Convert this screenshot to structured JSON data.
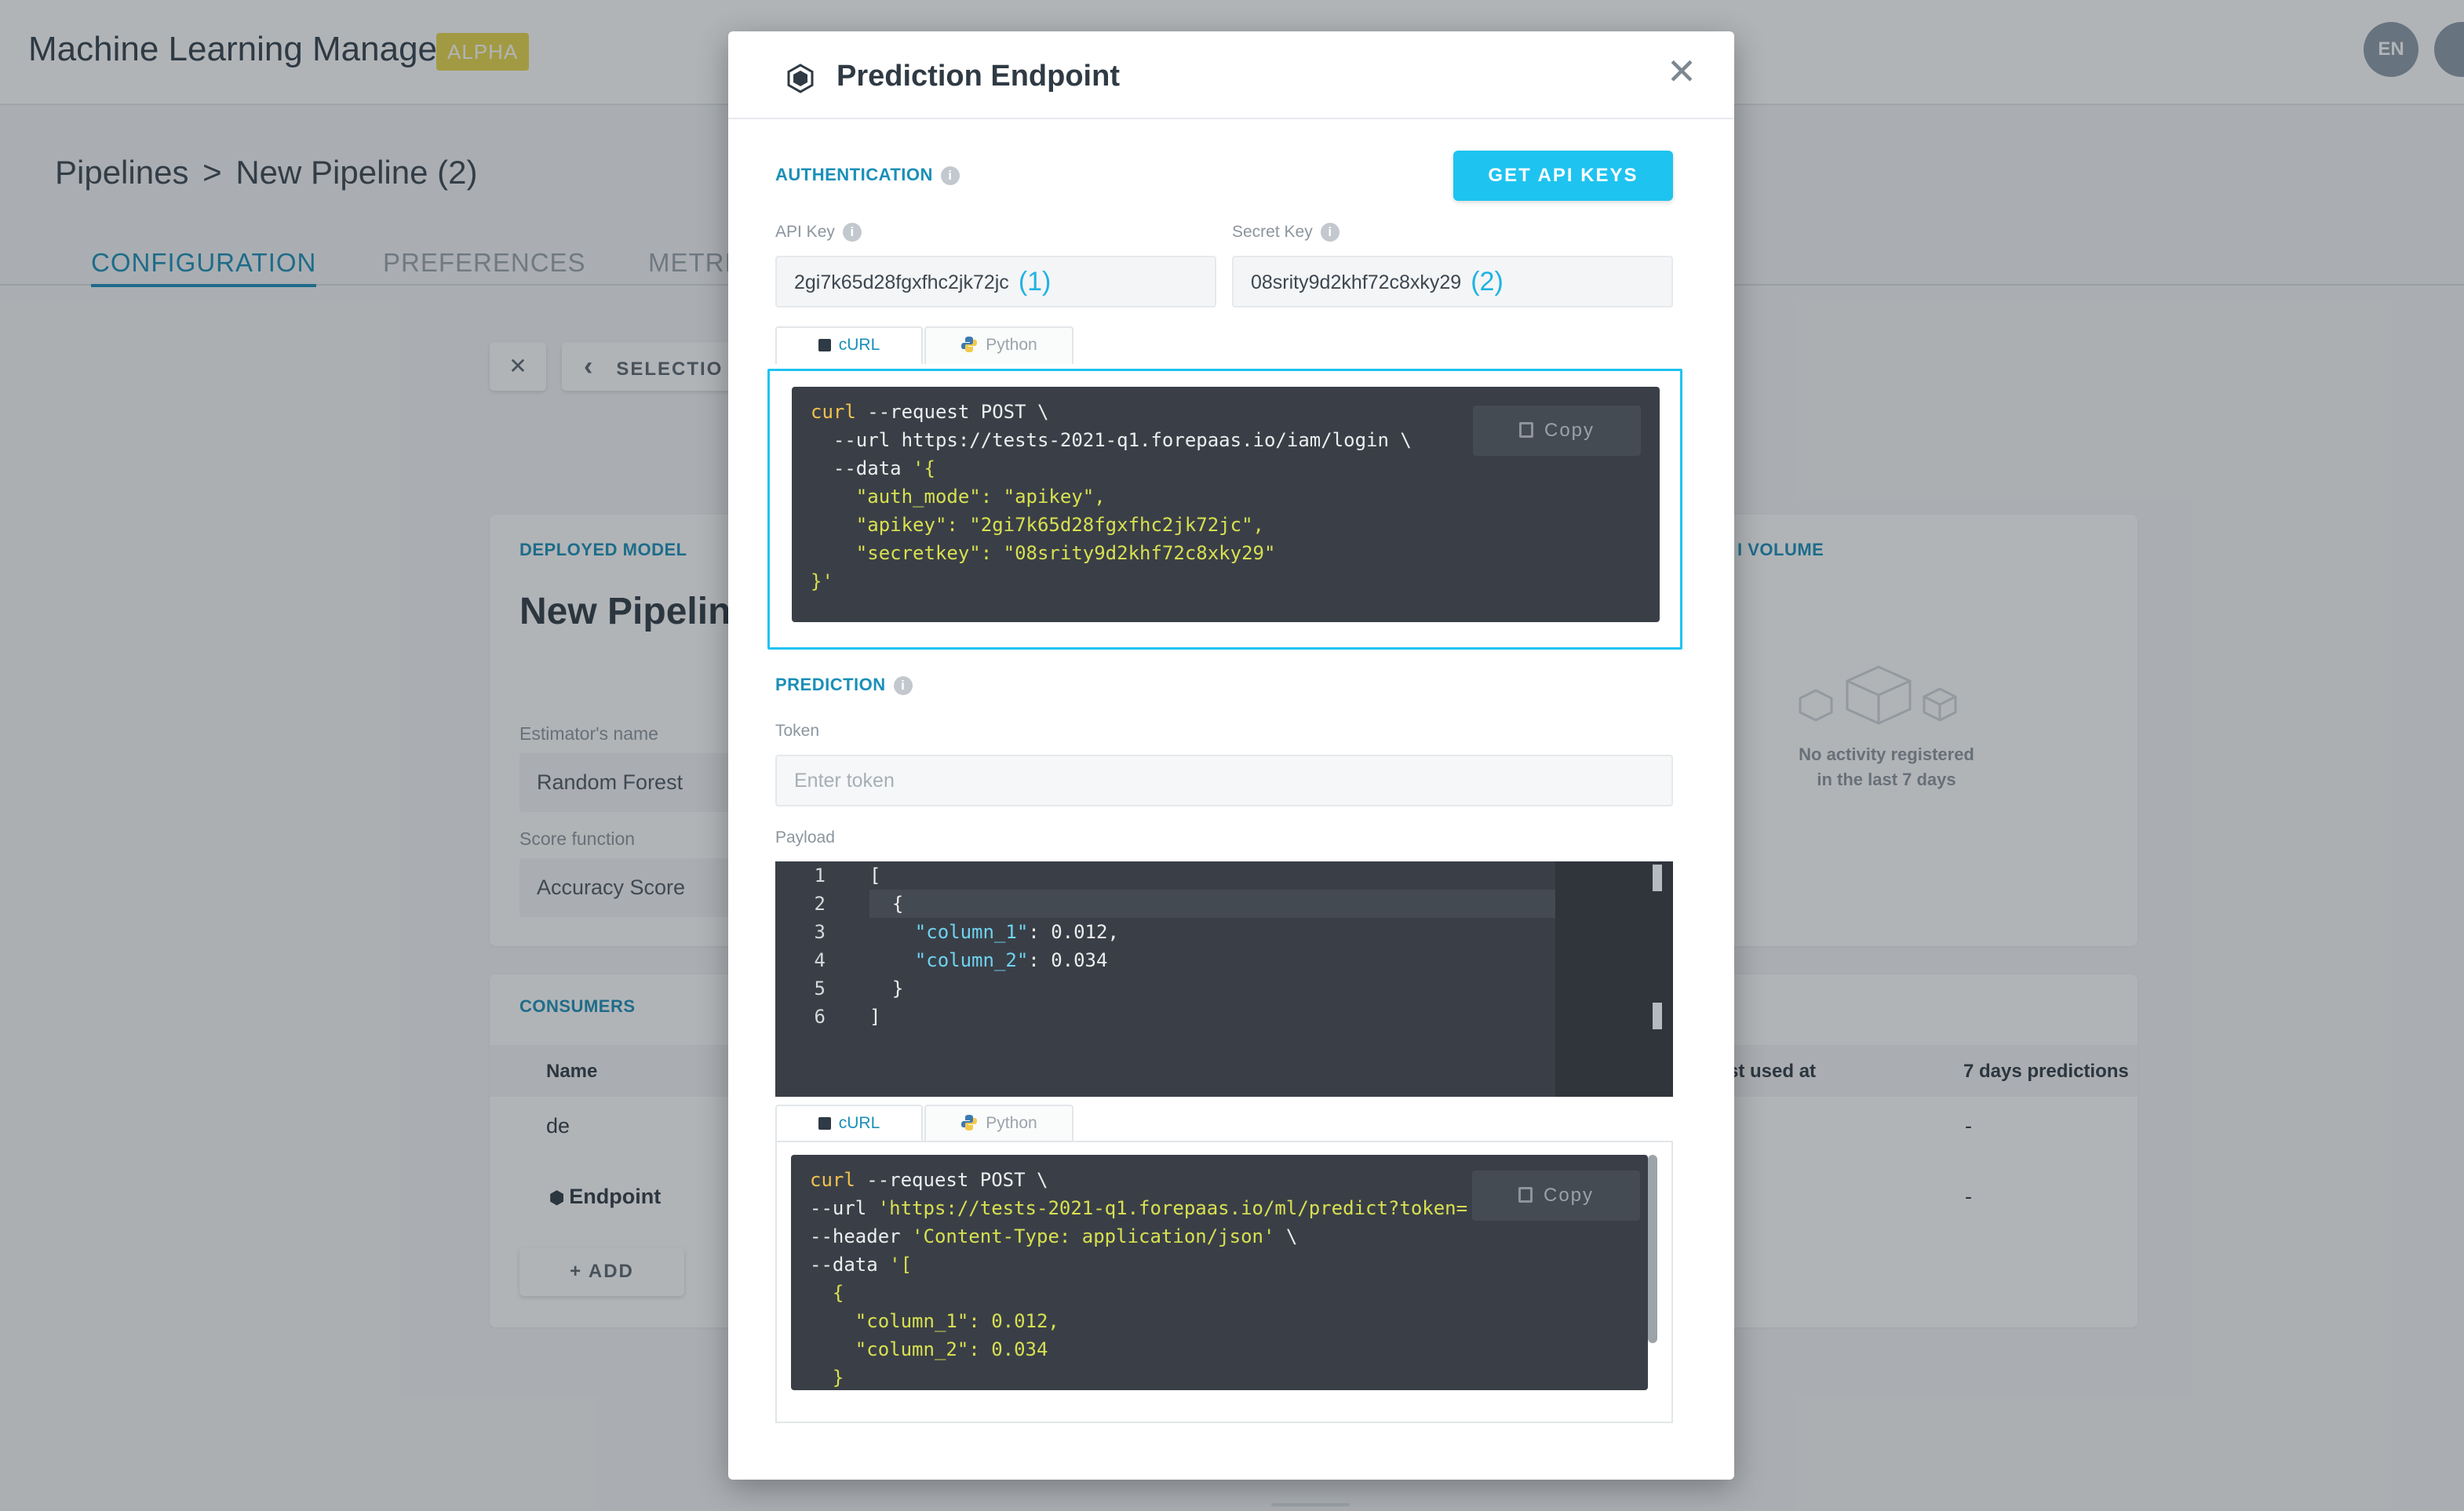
{
  "app": {
    "title": "Machine Learning Manager",
    "badge": "ALPHA",
    "lang": "EN"
  },
  "breadcrumb": {
    "root": "Pipelines",
    "separator": ">",
    "current": "New Pipeline (2)"
  },
  "tabs": [
    "CONFIGURATION",
    "PREFERENCES",
    "METRIC"
  ],
  "toolbar": {
    "close_glyph": "✕",
    "back_glyph": "‹",
    "selection_label": "SELECTIO"
  },
  "deployed": {
    "label": "DEPLOYED MODEL",
    "name": "New Pipelin",
    "estimator_label": "Estimator's name",
    "estimator_value": "Random Forest",
    "score_label": "Score function",
    "score_value": "Accuracy Score"
  },
  "volume": {
    "label": "I VOLUME",
    "empty_line1": "No activity registered",
    "empty_line2": "in the last 7 days"
  },
  "consumers": {
    "label": "CONSUMERS",
    "columns": {
      "name": "Name",
      "last_used": "st used at",
      "predictions": "7 days predictions"
    },
    "rows": [
      {
        "name": "de",
        "predictions": "-"
      },
      {
        "name": "Endpoint",
        "predictions": "-"
      }
    ],
    "add_label": "+ ADD"
  },
  "modal": {
    "title": "Prediction Endpoint",
    "close_glyph": "✕",
    "auth_label": "AUTHENTICATION",
    "info_glyph": "i",
    "get_keys_label": "GET API KEYS",
    "api_key_label": "API Key",
    "api_key_value": "2gi7k65d28fgxfhc2jk72jc",
    "api_key_marker": "(1)",
    "secret_key_label": "Secret Key",
    "secret_key_value": "08srity9d2khf72c8xky29",
    "secret_key_marker": "(2)",
    "tab_curl": "cURL",
    "tab_python": "Python",
    "copy_label": "Copy",
    "auth_code": [
      [
        [
          "kw",
          "curl"
        ],
        [
          "plain",
          " --request POST \\"
        ]
      ],
      [
        [
          "plain",
          "  --url https://tests-2021-q1.forepaas.io/iam/login \\"
        ]
      ],
      [
        [
          "plain",
          "  --data "
        ],
        [
          "str",
          "'{"
        ]
      ],
      [
        [
          "str",
          "    \"auth_mode\": \"apikey\","
        ]
      ],
      [
        [
          "str",
          "    \"apikey\": \"2gi7k65d28fgxfhc2jk72jc\","
        ]
      ],
      [
        [
          "str",
          "    \"secretkey\": \"08srity9d2khf72c8xky29\""
        ]
      ],
      [
        [
          "str",
          "}'"
        ]
      ]
    ],
    "prediction_label": "PREDICTION",
    "token_label": "Token",
    "token_placeholder": "Enter token",
    "payload_label": "Payload",
    "payload_lines": [
      {
        "num": "1",
        "parts": [
          [
            "plain",
            "["
          ]
        ]
      },
      {
        "num": "2",
        "parts": [
          [
            "plain",
            "  {"
          ]
        ]
      },
      {
        "num": "3",
        "parts": [
          [
            "plain",
            "    "
          ],
          [
            "key",
            "\"column_1\""
          ],
          [
            "plain",
            ": 0.012,"
          ]
        ]
      },
      {
        "num": "4",
        "parts": [
          [
            "plain",
            "    "
          ],
          [
            "key",
            "\"column_2\""
          ],
          [
            "plain",
            ": 0.034"
          ]
        ]
      },
      {
        "num": "5",
        "parts": [
          [
            "plain",
            "  }"
          ]
        ]
      },
      {
        "num": "6",
        "parts": [
          [
            "plain",
            "]"
          ]
        ]
      }
    ],
    "predict_code": [
      [
        [
          "kw",
          "curl"
        ],
        [
          "plain",
          " --request POST \\"
        ]
      ],
      [
        [
          "plain",
          "--url "
        ],
        [
          "str",
          "'https://tests-2021-q1.forepaas.io/ml/predict?token='"
        ],
        [
          "plain",
          " \\"
        ]
      ],
      [
        [
          "plain",
          "--header "
        ],
        [
          "str",
          "'Content-Type: application/json'"
        ],
        [
          "plain",
          " \\"
        ]
      ],
      [
        [
          "plain",
          "--data "
        ],
        [
          "str",
          "'["
        ]
      ],
      [
        [
          "str",
          "  {"
        ]
      ],
      [
        [
          "str",
          "    \"column_1\": 0.012,"
        ]
      ],
      [
        [
          "str",
          "    \"column_2\": 0.034"
        ]
      ],
      [
        [
          "str",
          "  }"
        ]
      ]
    ]
  }
}
